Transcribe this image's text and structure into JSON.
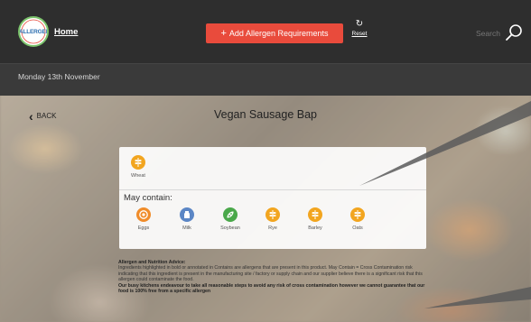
{
  "header": {
    "logo_text": "ALLERGEN",
    "home_label": "Home",
    "add_button_label": "Add Allergen Requirements",
    "add_button_plus": "+",
    "reset_label": "Reset",
    "search_label": "Search"
  },
  "date_bar": {
    "date": "Monday 13th November"
  },
  "page": {
    "back_label": "BACK",
    "title": "Vegan Sausage Bap"
  },
  "contains": [
    {
      "label": "Wheat",
      "icon": "wheat-icon",
      "color": "#f2a51f"
    }
  ],
  "may_contain": {
    "heading": "May contain:",
    "items": [
      {
        "label": "Eggs",
        "icon": "egg-icon",
        "color": "#f08c2a"
      },
      {
        "label": "Milk",
        "icon": "milk-icon",
        "color": "#5b86c5"
      },
      {
        "label": "Soybean",
        "icon": "soybean-icon",
        "color": "#4aa84a"
      },
      {
        "label": "Rye",
        "icon": "wheat-icon",
        "color": "#f2a51f"
      },
      {
        "label": "Barley",
        "icon": "wheat-icon",
        "color": "#f2a51f"
      },
      {
        "label": "Oats",
        "icon": "wheat-icon",
        "color": "#f2a51f"
      }
    ]
  },
  "advice": {
    "heading": "Allergen and Nutrition Advice:",
    "body": "Ingredients highlighted in bold or annotated in Contains are allergens that are present in this product. May Contain = Cross Contamination risk indicating that this ingredient is present in the manufacturing site / factory or supply chain and our supplier believe there is a significant risk that this allergen could contaminate the food.",
    "bold_note": "Our busy kitchens endeavour to take all reasonable steps to avoid any risk of cross contamination however we cannot guarantee that our food is 100% free from a specific allergen"
  },
  "colors": {
    "topbar": "#2e2e2e",
    "datebar": "#3a3a3a",
    "accent": "#e94b3c",
    "logo_ring": "#7cc46c"
  }
}
